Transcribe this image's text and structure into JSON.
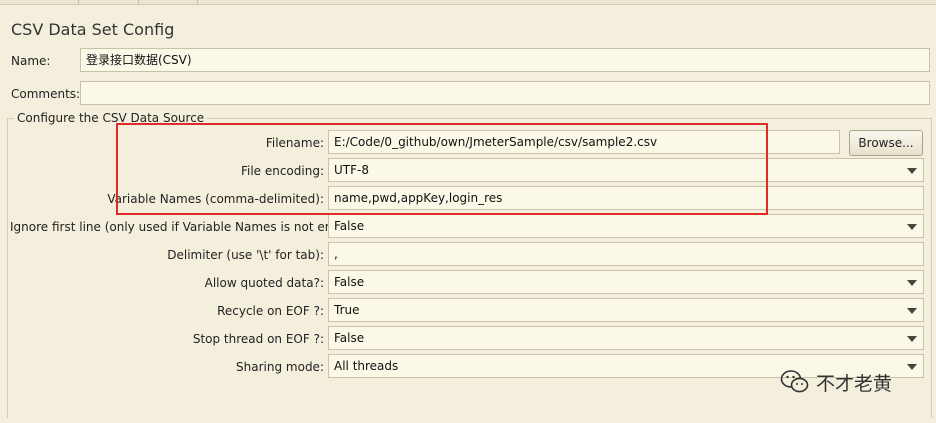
{
  "panel": {
    "title": "CSV Data Set Config"
  },
  "name": {
    "label": "Name:",
    "value": "登录接口数据(CSV)"
  },
  "comments": {
    "label": "Comments:",
    "value": ""
  },
  "source_group": {
    "legend": "Configure the CSV Data Source"
  },
  "fields": {
    "filename": {
      "label": "Filename:",
      "value": "E:/Code/0_github/own/JmeterSample/csv/sample2.csv",
      "browse_label": "Browse..."
    },
    "file_encoding": {
      "label": "File encoding:",
      "value": "UTF-8"
    },
    "variable_names": {
      "label": "Variable Names (comma-delimited):",
      "value": "name,pwd,appKey,login_res"
    },
    "ignore_first_line": {
      "label": "Ignore first line (only used if Variable Names is not empty):",
      "value": "False"
    },
    "delimiter": {
      "label": "Delimiter (use '\\t' for tab):",
      "value": ","
    },
    "allow_quoted": {
      "label": "Allow quoted data?:",
      "value": "False"
    },
    "recycle_eof": {
      "label": "Recycle on EOF ?:",
      "value": "True"
    },
    "stop_thread_eof": {
      "label": "Stop thread on EOF ?:",
      "value": "False"
    },
    "sharing_mode": {
      "label": "Sharing mode:",
      "value": "All threads"
    }
  },
  "watermark": {
    "text": "不才老黄",
    "icon": "wechat-icon"
  },
  "colors": {
    "highlight_box": "#e02b2b",
    "background": "#f4efdc",
    "field_bg": "#fcf8e8"
  }
}
